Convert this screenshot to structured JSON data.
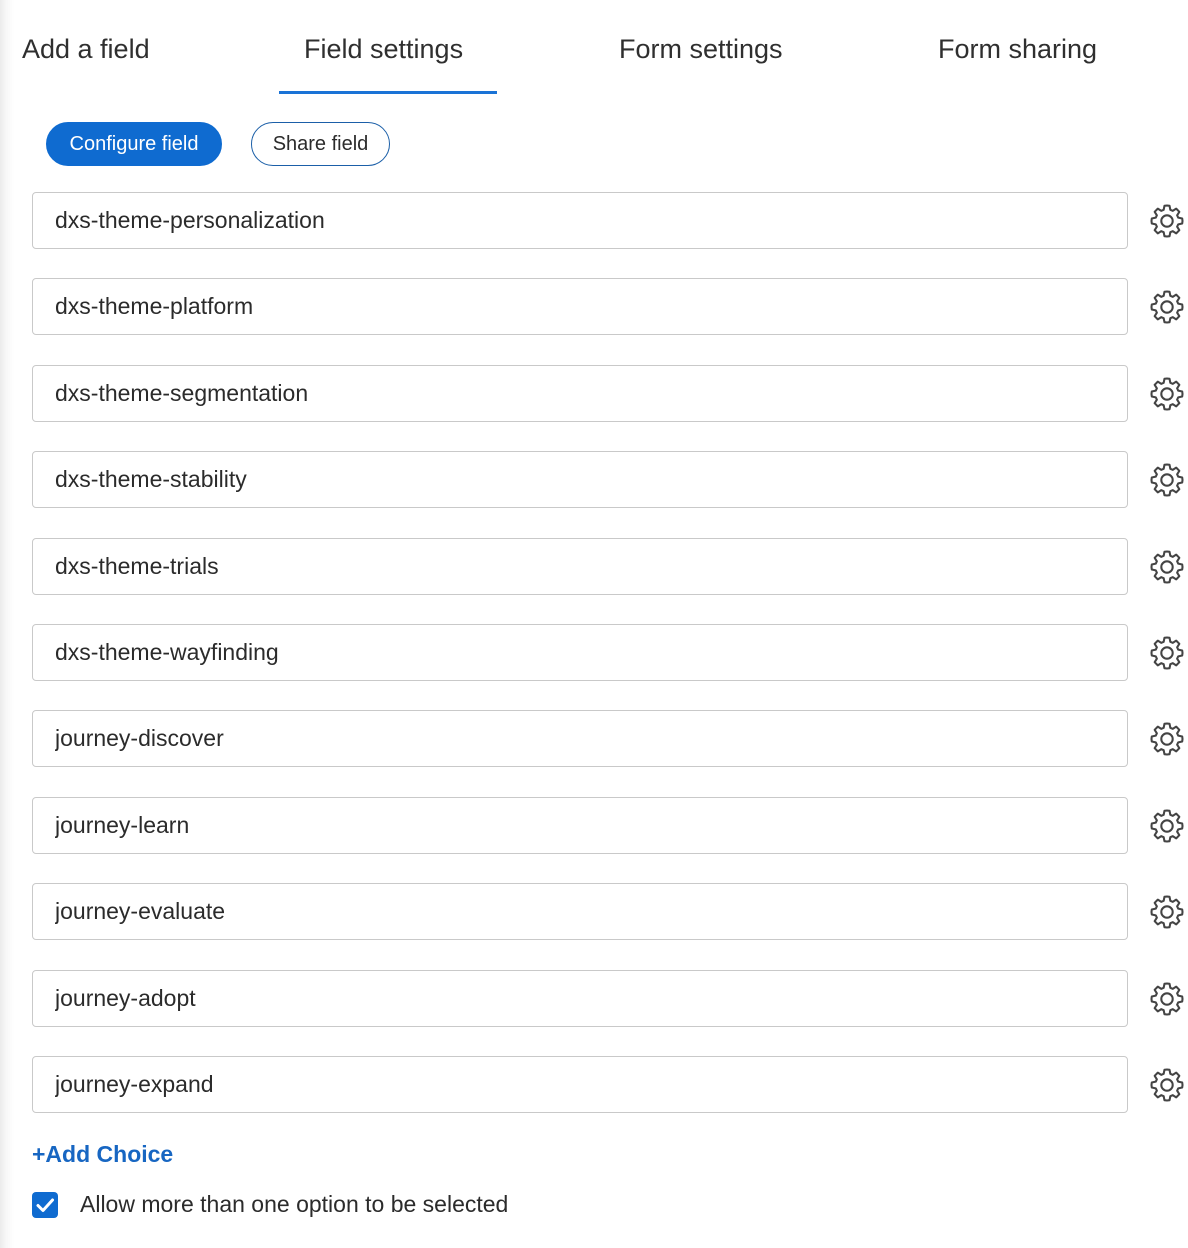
{
  "tabs": [
    {
      "label": "Add a field"
    },
    {
      "label": "Field settings",
      "active": true
    },
    {
      "label": "Form settings"
    },
    {
      "label": "Form sharing"
    }
  ],
  "subnav": {
    "configure_label": "Configure field",
    "share_label": "Share field"
  },
  "choices": [
    {
      "value": "dxs-theme-personalization"
    },
    {
      "value": "dxs-theme-platform"
    },
    {
      "value": "dxs-theme-segmentation"
    },
    {
      "value": "dxs-theme-stability"
    },
    {
      "value": "dxs-theme-trials"
    },
    {
      "value": "dxs-theme-wayfinding"
    },
    {
      "value": "journey-discover"
    },
    {
      "value": "journey-learn"
    },
    {
      "value": "journey-evaluate"
    },
    {
      "value": "journey-adopt"
    },
    {
      "value": "journey-expand"
    }
  ],
  "add_choice_label": "+Add Choice",
  "multi_select": {
    "label": "Allow more than one option to be selected",
    "checked": true
  },
  "icons": {
    "choice_settings": "gear-icon",
    "checkbox": "checkmark-icon"
  },
  "colors": {
    "accent": "#0f6bd0",
    "link": "#1766c2",
    "tab_underline": "#1a73d6"
  }
}
